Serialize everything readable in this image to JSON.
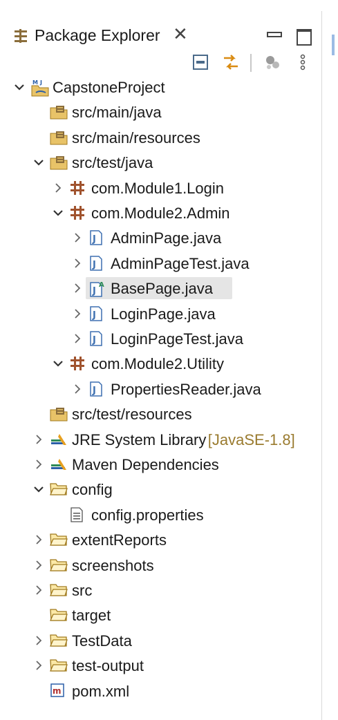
{
  "view": {
    "title": "Package Explorer",
    "close_glyph": "✕"
  },
  "toolbar": {
    "buttons": [
      "collapse-all-icon",
      "link-with-editor-icon",
      "focus-active-task-icon",
      "view-menu-icon"
    ]
  },
  "tree": [
    {
      "label": "CapstoneProject",
      "icon": "java-project-icon",
      "expanded": true,
      "level": 0,
      "twisty": "open"
    },
    {
      "label": "src/main/java",
      "icon": "source-folder-icon",
      "level": 1,
      "twisty": "none"
    },
    {
      "label": "src/main/resources",
      "icon": "source-folder-icon",
      "level": 1,
      "twisty": "none"
    },
    {
      "label": "src/test/java",
      "icon": "source-folder-icon",
      "level": 1,
      "twisty": "open"
    },
    {
      "label": "com.Module1.Login",
      "icon": "package-icon",
      "level": 2,
      "twisty": "closed"
    },
    {
      "label": "com.Module2.Admin",
      "icon": "package-icon",
      "level": 2,
      "twisty": "open"
    },
    {
      "label": "AdminPage.java",
      "icon": "java-file-icon",
      "level": 3,
      "twisty": "closed"
    },
    {
      "label": "AdminPageTest.java",
      "icon": "java-file-icon",
      "level": 3,
      "twisty": "closed"
    },
    {
      "label": "BasePage.java",
      "icon": "abstract-java-file-icon",
      "level": 3,
      "twisty": "closed",
      "selected": true
    },
    {
      "label": "LoginPage.java",
      "icon": "java-file-icon",
      "level": 3,
      "twisty": "closed"
    },
    {
      "label": "LoginPageTest.java",
      "icon": "java-file-icon",
      "level": 3,
      "twisty": "closed"
    },
    {
      "label": "com.Module2.Utility",
      "icon": "package-icon",
      "level": 2,
      "twisty": "open"
    },
    {
      "label": "PropertiesReader.java",
      "icon": "java-file-icon",
      "level": 3,
      "twisty": "closed"
    },
    {
      "label": "src/test/resources",
      "icon": "source-folder-icon",
      "level": 1,
      "twisty": "none"
    },
    {
      "label": "JRE System Library",
      "decoration": "[JavaSE-1.8]",
      "icon": "library-icon",
      "level": 1,
      "twisty": "closed"
    },
    {
      "label": "Maven Dependencies",
      "icon": "library-icon",
      "level": 1,
      "twisty": "closed"
    },
    {
      "label": "config",
      "icon": "folder-icon",
      "level": 1,
      "twisty": "open"
    },
    {
      "label": "config.properties",
      "icon": "text-file-icon",
      "level": 2,
      "twisty": "none"
    },
    {
      "label": "extentReports",
      "icon": "folder-icon",
      "level": 1,
      "twisty": "closed"
    },
    {
      "label": "screenshots",
      "icon": "folder-icon",
      "level": 1,
      "twisty": "closed"
    },
    {
      "label": "src",
      "icon": "folder-icon",
      "level": 1,
      "twisty": "closed"
    },
    {
      "label": "target",
      "icon": "folder-icon",
      "level": 1,
      "twisty": "none"
    },
    {
      "label": "TestData",
      "icon": "folder-icon",
      "level": 1,
      "twisty": "closed"
    },
    {
      "label": "test-output",
      "icon": "folder-icon",
      "level": 1,
      "twisty": "closed"
    },
    {
      "label": "pom.xml",
      "icon": "maven-pom-icon",
      "level": 1,
      "twisty": "none"
    }
  ]
}
